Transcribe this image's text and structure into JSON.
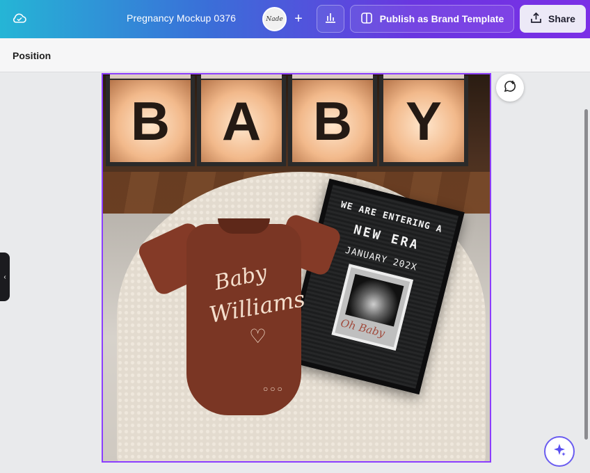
{
  "header": {
    "doc_title": "Pregnancy Mockup 0376",
    "avatar_text": "Nade",
    "add_label": "+",
    "publish_label": "Publish as Brand Template",
    "share_label": "Share"
  },
  "toolbar": {
    "position_label": "Position"
  },
  "design": {
    "blocks": [
      "B",
      "A",
      "B",
      "Y"
    ],
    "onesie_line1": "Baby",
    "onesie_line2": "Williams",
    "board_line1": "WE ARE ENTERING A",
    "board_line2": "NEW ERA",
    "board_line3": "JANUARY 202X",
    "ultrasound_label": "Oh Baby"
  },
  "colors": {
    "selection": "#8b3dff",
    "header_start": "#25b5d6",
    "header_end": "#7b2fe6"
  },
  "icons": {
    "cloud": "cloud-icon",
    "stats": "bar-chart-icon",
    "publish": "template-icon",
    "share": "upload-icon",
    "comment": "add-comment-icon",
    "magic": "sparkle-icon"
  }
}
